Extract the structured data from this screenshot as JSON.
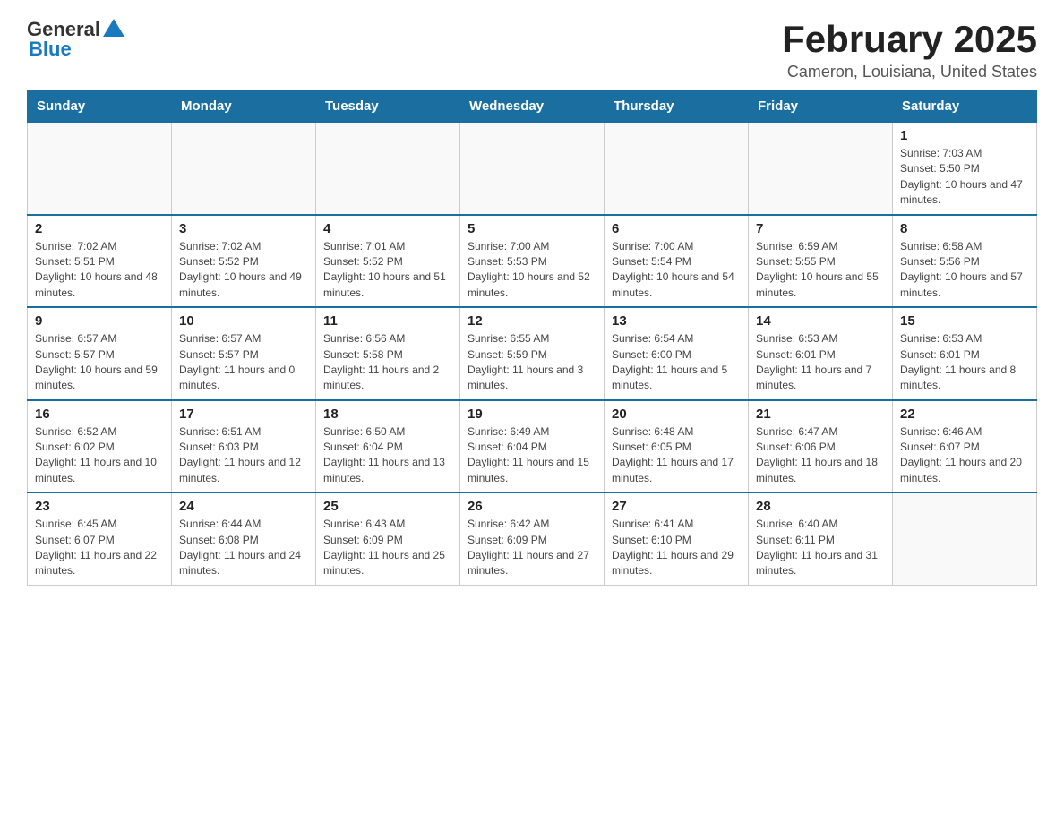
{
  "header": {
    "logo_general": "General",
    "logo_blue": "Blue",
    "title": "February 2025",
    "subtitle": "Cameron, Louisiana, United States"
  },
  "calendar": {
    "days_of_week": [
      "Sunday",
      "Monday",
      "Tuesday",
      "Wednesday",
      "Thursday",
      "Friday",
      "Saturday"
    ],
    "weeks": [
      [
        {
          "day": "",
          "info": ""
        },
        {
          "day": "",
          "info": ""
        },
        {
          "day": "",
          "info": ""
        },
        {
          "day": "",
          "info": ""
        },
        {
          "day": "",
          "info": ""
        },
        {
          "day": "",
          "info": ""
        },
        {
          "day": "1",
          "info": "Sunrise: 7:03 AM\nSunset: 5:50 PM\nDaylight: 10 hours and 47 minutes."
        }
      ],
      [
        {
          "day": "2",
          "info": "Sunrise: 7:02 AM\nSunset: 5:51 PM\nDaylight: 10 hours and 48 minutes."
        },
        {
          "day": "3",
          "info": "Sunrise: 7:02 AM\nSunset: 5:52 PM\nDaylight: 10 hours and 49 minutes."
        },
        {
          "day": "4",
          "info": "Sunrise: 7:01 AM\nSunset: 5:52 PM\nDaylight: 10 hours and 51 minutes."
        },
        {
          "day": "5",
          "info": "Sunrise: 7:00 AM\nSunset: 5:53 PM\nDaylight: 10 hours and 52 minutes."
        },
        {
          "day": "6",
          "info": "Sunrise: 7:00 AM\nSunset: 5:54 PM\nDaylight: 10 hours and 54 minutes."
        },
        {
          "day": "7",
          "info": "Sunrise: 6:59 AM\nSunset: 5:55 PM\nDaylight: 10 hours and 55 minutes."
        },
        {
          "day": "8",
          "info": "Sunrise: 6:58 AM\nSunset: 5:56 PM\nDaylight: 10 hours and 57 minutes."
        }
      ],
      [
        {
          "day": "9",
          "info": "Sunrise: 6:57 AM\nSunset: 5:57 PM\nDaylight: 10 hours and 59 minutes."
        },
        {
          "day": "10",
          "info": "Sunrise: 6:57 AM\nSunset: 5:57 PM\nDaylight: 11 hours and 0 minutes."
        },
        {
          "day": "11",
          "info": "Sunrise: 6:56 AM\nSunset: 5:58 PM\nDaylight: 11 hours and 2 minutes."
        },
        {
          "day": "12",
          "info": "Sunrise: 6:55 AM\nSunset: 5:59 PM\nDaylight: 11 hours and 3 minutes."
        },
        {
          "day": "13",
          "info": "Sunrise: 6:54 AM\nSunset: 6:00 PM\nDaylight: 11 hours and 5 minutes."
        },
        {
          "day": "14",
          "info": "Sunrise: 6:53 AM\nSunset: 6:01 PM\nDaylight: 11 hours and 7 minutes."
        },
        {
          "day": "15",
          "info": "Sunrise: 6:53 AM\nSunset: 6:01 PM\nDaylight: 11 hours and 8 minutes."
        }
      ],
      [
        {
          "day": "16",
          "info": "Sunrise: 6:52 AM\nSunset: 6:02 PM\nDaylight: 11 hours and 10 minutes."
        },
        {
          "day": "17",
          "info": "Sunrise: 6:51 AM\nSunset: 6:03 PM\nDaylight: 11 hours and 12 minutes."
        },
        {
          "day": "18",
          "info": "Sunrise: 6:50 AM\nSunset: 6:04 PM\nDaylight: 11 hours and 13 minutes."
        },
        {
          "day": "19",
          "info": "Sunrise: 6:49 AM\nSunset: 6:04 PM\nDaylight: 11 hours and 15 minutes."
        },
        {
          "day": "20",
          "info": "Sunrise: 6:48 AM\nSunset: 6:05 PM\nDaylight: 11 hours and 17 minutes."
        },
        {
          "day": "21",
          "info": "Sunrise: 6:47 AM\nSunset: 6:06 PM\nDaylight: 11 hours and 18 minutes."
        },
        {
          "day": "22",
          "info": "Sunrise: 6:46 AM\nSunset: 6:07 PM\nDaylight: 11 hours and 20 minutes."
        }
      ],
      [
        {
          "day": "23",
          "info": "Sunrise: 6:45 AM\nSunset: 6:07 PM\nDaylight: 11 hours and 22 minutes."
        },
        {
          "day": "24",
          "info": "Sunrise: 6:44 AM\nSunset: 6:08 PM\nDaylight: 11 hours and 24 minutes."
        },
        {
          "day": "25",
          "info": "Sunrise: 6:43 AM\nSunset: 6:09 PM\nDaylight: 11 hours and 25 minutes."
        },
        {
          "day": "26",
          "info": "Sunrise: 6:42 AM\nSunset: 6:09 PM\nDaylight: 11 hours and 27 minutes."
        },
        {
          "day": "27",
          "info": "Sunrise: 6:41 AM\nSunset: 6:10 PM\nDaylight: 11 hours and 29 minutes."
        },
        {
          "day": "28",
          "info": "Sunrise: 6:40 AM\nSunset: 6:11 PM\nDaylight: 11 hours and 31 minutes."
        },
        {
          "day": "",
          "info": ""
        }
      ]
    ]
  }
}
